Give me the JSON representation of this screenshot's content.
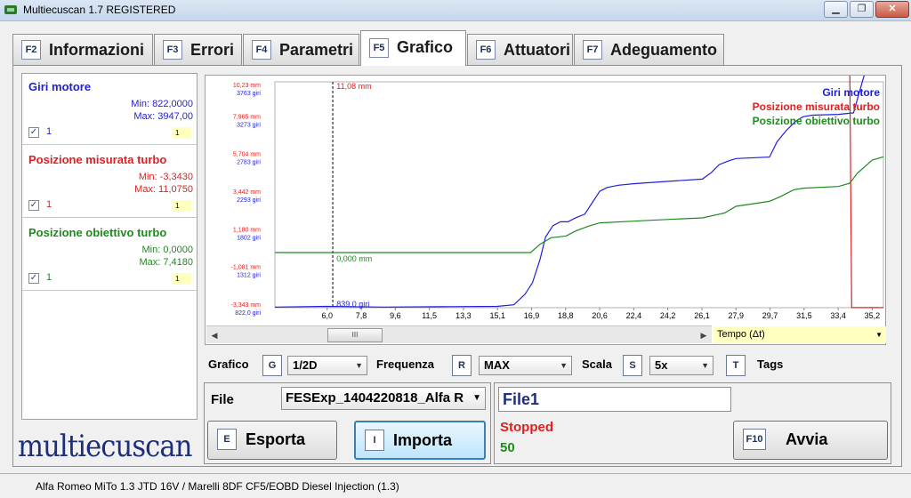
{
  "window": {
    "title": "Multiecuscan 1.7 REGISTERED",
    "minimize_glyph": "▁",
    "maximize_glyph": "❐",
    "close_glyph": "✕"
  },
  "tabs": [
    {
      "key": "F2",
      "label": "Informazioni",
      "active": false
    },
    {
      "key": "F3",
      "label": "Errori",
      "active": false
    },
    {
      "key": "F4",
      "label": "Parametri",
      "active": false
    },
    {
      "key": "F5",
      "label": "Grafico",
      "active": true
    },
    {
      "key": "F6",
      "label": "Attuatori",
      "active": false
    },
    {
      "key": "F7",
      "label": "Adeguamento",
      "active": false
    }
  ],
  "legend": [
    {
      "name": "Giri motore",
      "color": "#1f1fd8",
      "min": "Min: 822,0000",
      "max": "Max: 3947,00",
      "checked": true,
      "index": "1",
      "scale": "1"
    },
    {
      "name": "Posizione misurata turbo",
      "color": "#e02020",
      "min": "Min: -3,3430",
      "max": "Max: 11,0750",
      "checked": true,
      "index": "1",
      "scale": "1"
    },
    {
      "name": "Posizione obiettivo turbo",
      "color": "#1e8a1e",
      "min": "Min: 0,0000",
      "max": "Max: 7,4180",
      "checked": true,
      "index": "1",
      "scale": "1"
    }
  ],
  "logo": "multiecuscan",
  "chart_data": {
    "type": "line",
    "xlabel": "Tempo (Δt)",
    "x_ticks": [
      "6,0",
      "7,8",
      "9,6",
      "11,5",
      "13,3",
      "15,1",
      "16,9",
      "18,8",
      "20,6",
      "22,4",
      "24,2",
      "26,1",
      "27,9",
      "29,7",
      "31,5",
      "33,4",
      "35,2"
    ],
    "y_ticks_mm": [
      "10,23 mm",
      "7,965 mm",
      "5,704 mm",
      "3,442 mm",
      "1,180 mm",
      "-1,081 mm",
      "-3,343 mm"
    ],
    "y_ticks_giri": [
      "3763 giri",
      "3273 giri",
      "2783 giri",
      "2293 giri",
      "1802 giri",
      "1312 giri",
      "822,0 giri"
    ],
    "cursor_label": "11,08 mm",
    "annotations": [
      "0,000 mm",
      "839,0 giri"
    ],
    "legend_position": "top-right",
    "series": [
      {
        "name": "Giri motore",
        "color": "#1f1fd8",
        "x": [
          3.2,
          6.0,
          9.0,
          12.0,
          15.1,
          16.0,
          16.6,
          17.0,
          17.4,
          17.7,
          18.1,
          18.5,
          18.9,
          19.3,
          19.8,
          20.2,
          20.6,
          21.0,
          21.6,
          22.4,
          24.2,
          26.1,
          26.6,
          27.0,
          27.5,
          27.9,
          29.7,
          30.1,
          30.6,
          31.1,
          31.5,
          32.0,
          33.4,
          34.2,
          34.8,
          35.2,
          35.8
        ],
        "y": [
          830,
          839,
          830,
          835,
          840,
          860,
          1000,
          1150,
          1450,
          1750,
          1900,
          1950,
          1950,
          2000,
          2050,
          2200,
          2350,
          2400,
          2430,
          2450,
          2480,
          2510,
          2600,
          2700,
          2750,
          2780,
          2800,
          3000,
          3150,
          3270,
          3330,
          3350,
          3360,
          3380,
          3900,
          3940,
          3920
        ]
      },
      {
        "name": "Posizione misurata turbo",
        "color": "#e02020",
        "x": [
          3.2,
          34.0,
          34.1,
          35.8
        ],
        "y": [
          11.08,
          11.08,
          -3.34,
          -3.34
        ]
      },
      {
        "name": "Posizione obiettivo turbo",
        "color": "#1e8a1e",
        "x": [
          3.2,
          16.5,
          16.9,
          17.4,
          18.0,
          18.8,
          19.3,
          20.0,
          20.6,
          22.4,
          24.2,
          26.1,
          27.3,
          27.9,
          29.7,
          30.3,
          31.0,
          31.5,
          33.4,
          34.0,
          34.4,
          35.2,
          35.8
        ],
        "y": [
          0.0,
          0.0,
          0.0,
          0.5,
          0.9,
          1.0,
          1.3,
          1.6,
          1.8,
          1.9,
          2.0,
          2.1,
          2.4,
          2.8,
          3.1,
          3.4,
          3.8,
          3.9,
          4.0,
          4.2,
          4.8,
          5.6,
          5.8
        ]
      }
    ]
  },
  "controls": {
    "grafico_label": "Grafico",
    "grafico_key": "G",
    "grafico_value": "1/2D",
    "frequenza_label": "Frequenza",
    "frequenza_key": "R",
    "frequenza_value": "MAX",
    "scala_label": "Scala",
    "scala_key": "S",
    "scala_value": "5x",
    "tags_key": "T",
    "tags_label": "Tags"
  },
  "file_panel": {
    "label": "File",
    "value": "FESExp_1404220818_Alfa R",
    "export_key": "E",
    "export_label": "Esporta",
    "import_key": "I",
    "import_label": "Importa"
  },
  "run_panel": {
    "file_name": "File1",
    "status": "Stopped",
    "count": "50",
    "start_key": "F10",
    "start_label": "Avvia"
  },
  "statusbar": {
    "text": "Alfa Romeo MiTo 1.3 JTD 16V / Marelli 8DF CF5/EOBD Diesel Injection (1.3)"
  },
  "scrollbar": {
    "thumb_glyph": "III",
    "left_glyph": "◀",
    "right_glyph": "▶",
    "dropdown_glyph": "▼"
  }
}
